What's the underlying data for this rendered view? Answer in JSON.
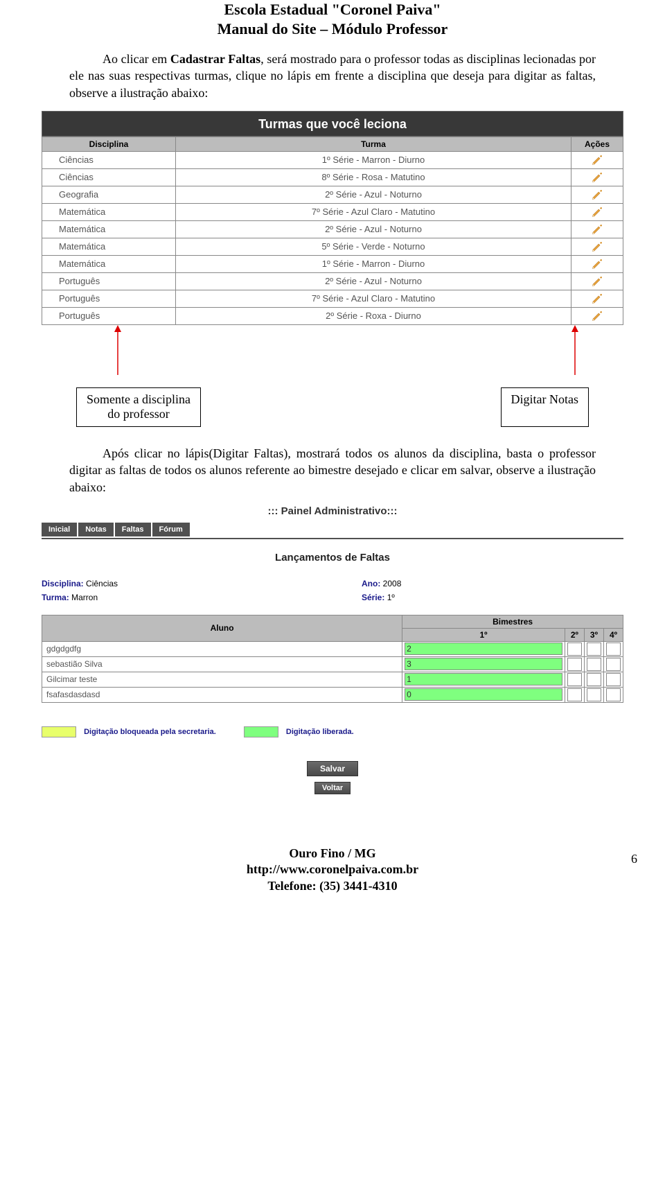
{
  "header": {
    "line1": "Escola Estadual \"Coronel Paiva\"",
    "line2": "Manual do Site – Módulo Professor"
  },
  "para1_pre": "Ao clicar em ",
  "para1_bold": "Cadastrar Faltas",
  "para1_post": ", será mostrado para o professor todas as disciplinas lecionadas por ele nas suas respectivas turmas, clique no lápis em frente a disciplina que deseja para digitar as faltas, observe a ilustração abaixo:",
  "table1": {
    "title": "Turmas que você leciona",
    "cols": [
      "Disciplina",
      "Turma",
      "Ações"
    ],
    "rows": [
      [
        "Ciências",
        "1º Série - Marron - Diurno"
      ],
      [
        "Ciências",
        "8º Série - Rosa - Matutino"
      ],
      [
        "Geografia",
        "2º Série - Azul - Noturno"
      ],
      [
        "Matemática",
        "7º Série - Azul Claro - Matutino"
      ],
      [
        "Matemática",
        "2º Série - Azul - Noturno"
      ],
      [
        "Matemática",
        "5º Série - Verde - Noturno"
      ],
      [
        "Matemática",
        "1º Série - Marron - Diurno"
      ],
      [
        "Português",
        "2º Série - Azul - Noturno"
      ],
      [
        "Português",
        "7º Série - Azul Claro - Matutino"
      ],
      [
        "Português",
        "2º Série - Roxa - Diurno"
      ]
    ]
  },
  "callout_left_l1": "Somente a disciplina",
  "callout_left_l2": "do professor",
  "callout_right": "Digitar Notas",
  "para2": "Após clicar no lápis(Digitar Faltas), mostrará todos os alunos da disciplina, basta o professor digitar as faltas de todos os alunos referente ao bimestre desejado e clicar em salvar, observe a ilustração abaixo:",
  "panel": {
    "title": "::: Painel Administrativo:::",
    "tabs": [
      "Inicial",
      "Notas",
      "Faltas",
      "Fórum"
    ],
    "section": "Lançamentos de Faltas",
    "labels": {
      "disciplina": "Disciplina:",
      "turma": "Turma:",
      "ano": "Ano:",
      "serie": "Série:"
    },
    "values": {
      "disciplina": "Ciências",
      "turma": "Marron",
      "ano": "2008",
      "serie": "1º"
    },
    "bimestres_header": "Bimestres",
    "aluno_header": "Aluno",
    "bim_cols": [
      "1º",
      "2º",
      "3º",
      "4º"
    ],
    "rows": [
      {
        "aluno": "gdgdgdfg",
        "v1": "2"
      },
      {
        "aluno": "sebastião Silva",
        "v1": "3"
      },
      {
        "aluno": "Gilcimar teste",
        "v1": "1"
      },
      {
        "aluno": "fsafasdasdasd",
        "v1": "0"
      }
    ],
    "legend_blocked": "Digitação bloqueada pela secretaria.",
    "legend_open": "Digitação liberada.",
    "btn_save": "Salvar",
    "btn_back": "Voltar"
  },
  "footer": {
    "line1": "Ouro Fino / MG",
    "line2": "http://www.coronelpaiva.com.br",
    "line3": "Telefone: (35) 3441-4310",
    "page": "6"
  }
}
